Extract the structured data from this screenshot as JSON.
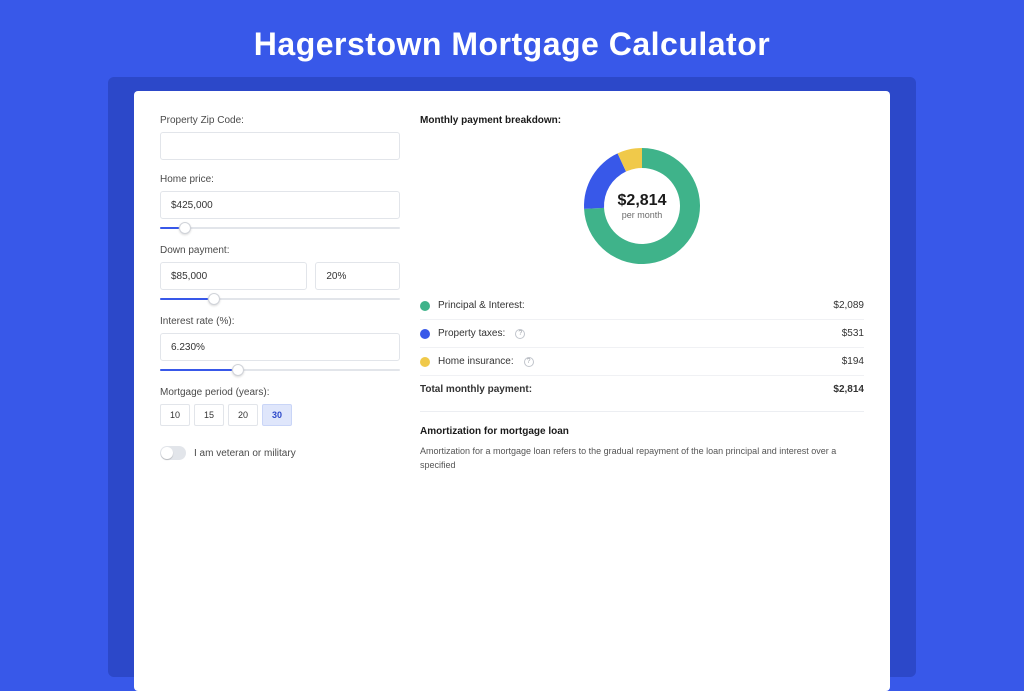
{
  "title": "Hagerstown Mortgage Calculator",
  "form": {
    "zip_label": "Property Zip Code:",
    "zip_value": "",
    "price_label": "Home price:",
    "price_value": "$425,000",
    "price_slider_pct": 8,
    "down_label": "Down payment:",
    "down_value": "$85,000",
    "down_pct": "20%",
    "down_slider_pct": 20,
    "rate_label": "Interest rate (%):",
    "rate_value": "6.230%",
    "rate_slider_pct": 30,
    "period_label": "Mortgage period (years):",
    "periods": [
      "10",
      "15",
      "20",
      "30"
    ],
    "period_selected": "30",
    "veteran_label": "I am veteran or military"
  },
  "breakdown": {
    "heading": "Monthly payment breakdown:",
    "total_amount": "$2,814",
    "total_sub": "per month",
    "rows": [
      {
        "name": "Principal & Interest:",
        "value": "$2,089",
        "color": "#3fb38a",
        "info": false
      },
      {
        "name": "Property taxes:",
        "value": "$531",
        "color": "#3858e9",
        "info": true
      },
      {
        "name": "Home insurance:",
        "value": "$194",
        "color": "#f0c94a",
        "info": true
      }
    ],
    "total_row": {
      "name": "Total monthly payment:",
      "value": "$2,814"
    }
  },
  "chart_data": {
    "type": "pie",
    "title": "Monthly payment breakdown",
    "categories": [
      "Principal & Interest",
      "Property taxes",
      "Home insurance"
    ],
    "values": [
      2089,
      531,
      194
    ],
    "colors": [
      "#3fb38a",
      "#3858e9",
      "#f0c94a"
    ],
    "center_label": "$2,814 per month",
    "arcs": [
      {
        "start": -90,
        "end": 177.2,
        "color": "#3fb38a"
      },
      {
        "start": 177.2,
        "end": 245.1,
        "color": "#3858e9"
      },
      {
        "start": 245.1,
        "end": 270,
        "color": "#f0c94a"
      }
    ]
  },
  "amort": {
    "heading": "Amortization for mortgage loan",
    "body": "Amortization for a mortgage loan refers to the gradual repayment of the loan principal and interest over a specified"
  }
}
